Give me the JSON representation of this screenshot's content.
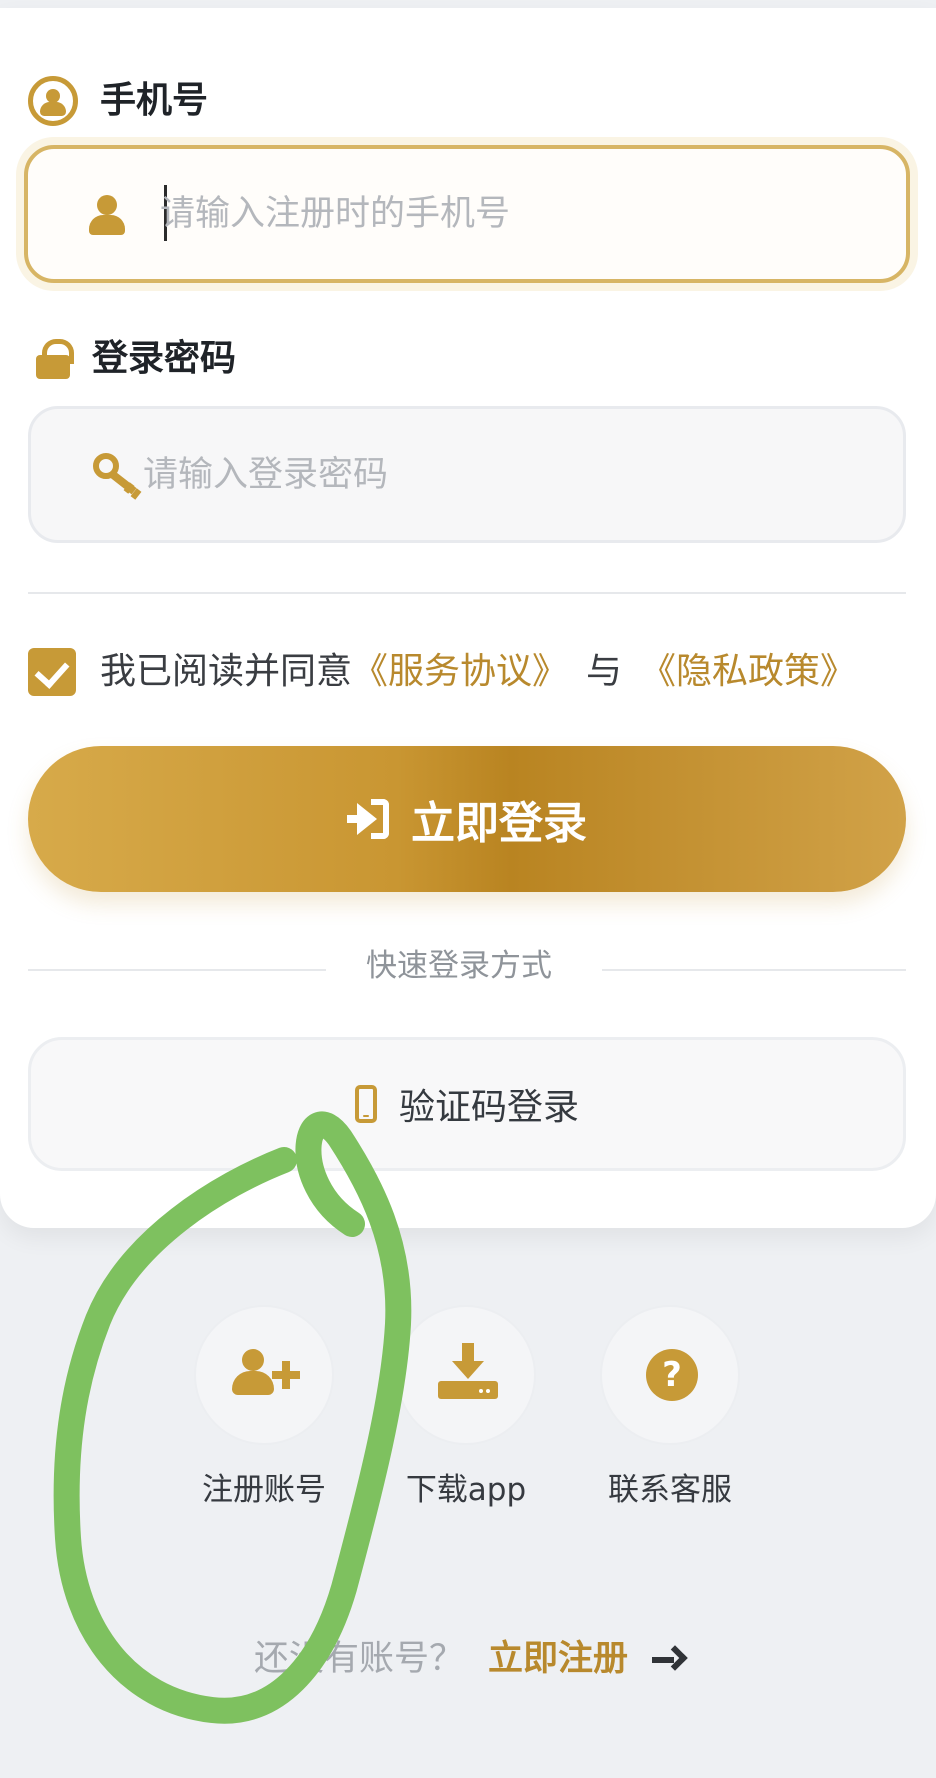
{
  "form": {
    "phone_label": "手机号",
    "phone_placeholder": "请输入注册时的手机号",
    "password_label": "登录密码",
    "password_placeholder": "请输入登录密码"
  },
  "agreement": {
    "prefix": "我已阅读并同意",
    "service": "《服务协议》",
    "join": "与",
    "privacy": "《隐私政策》"
  },
  "actions": {
    "login_label": "立即登录",
    "quick_title": "快速登录方式",
    "code_login_label": "验证码登录"
  },
  "shortcuts": [
    {
      "label": "注册账号",
      "icon": "add-user-icon"
    },
    {
      "label": "下载app",
      "icon": "download-icon"
    },
    {
      "label": "联系客服",
      "icon": "help-icon"
    }
  ],
  "footer": {
    "question": "还没有账号？",
    "register_link": "立即注册"
  },
  "colors": {
    "accent": "#c79a37",
    "annotation": "#7ec15f"
  },
  "icons": {
    "phone_label_icon": "user-circle-icon",
    "password_label_icon": "lock-icon",
    "phone_input_icon": "user-icon",
    "password_input_icon": "key-icon",
    "login_button_icon": "sign-in-icon",
    "code_login_icon": "mobile-phone-icon",
    "register_arrow_icon": "arrow-right-icon"
  }
}
